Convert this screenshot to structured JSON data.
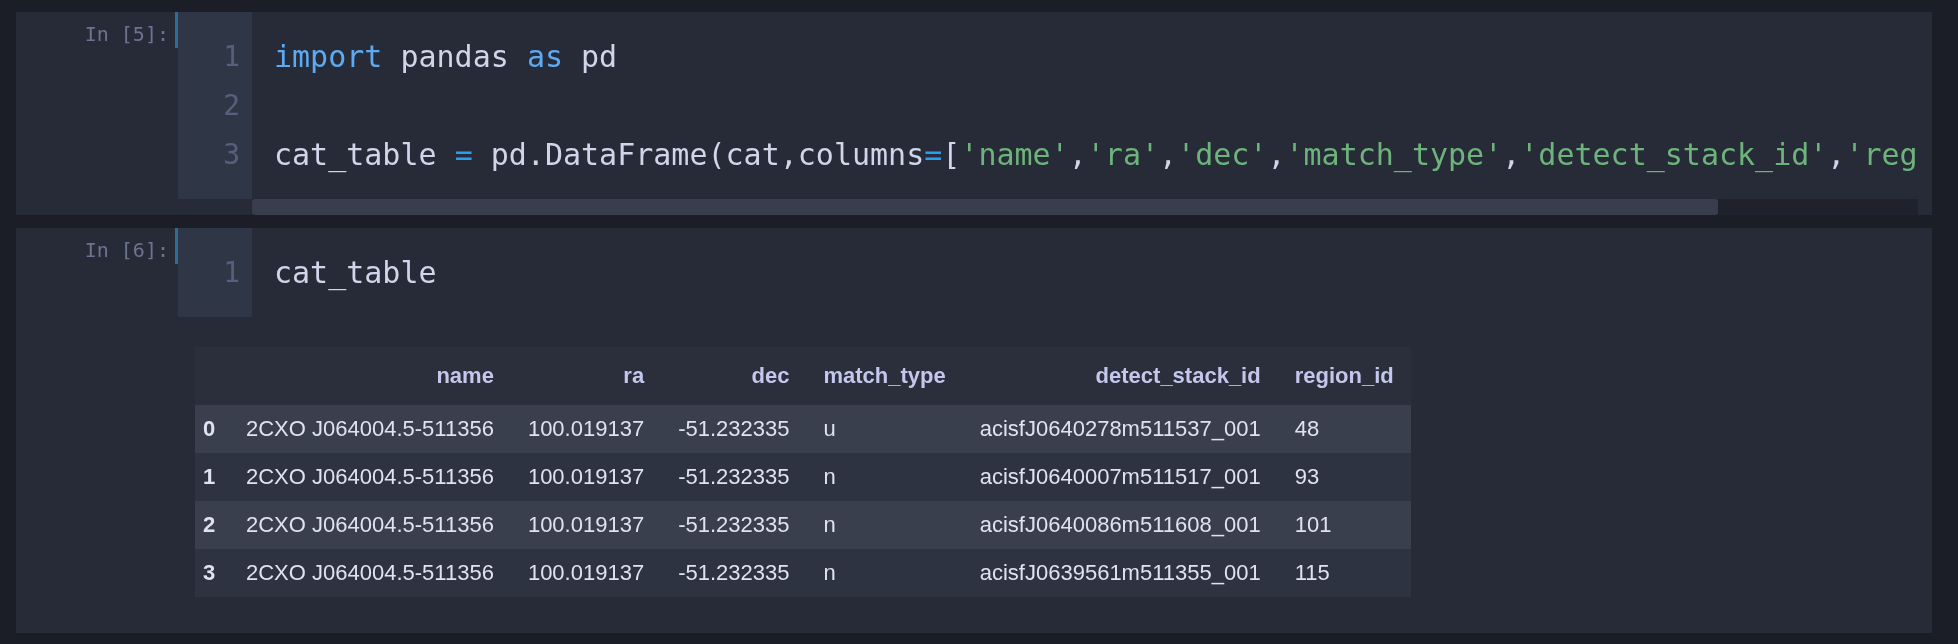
{
  "cells": [
    {
      "prompt": "In [5]:",
      "horizontal_scrollbar": true,
      "lines": [
        {
          "number": "1",
          "tokens": [
            {
              "kind": "keyword",
              "text": "import"
            },
            {
              "kind": "name",
              "text": " pandas "
            },
            {
              "kind": "keyword",
              "text": "as"
            },
            {
              "kind": "name",
              "text": " pd"
            }
          ]
        },
        {
          "number": "2"
        },
        {
          "number": "3",
          "tokens": [
            {
              "kind": "name",
              "text": "cat_table "
            },
            {
              "kind": "operator",
              "text": "="
            },
            {
              "kind": "name",
              "text": " pd.DataFrame(cat,columns"
            },
            {
              "kind": "operator",
              "text": "="
            },
            {
              "kind": "name",
              "text": "["
            },
            {
              "kind": "string",
              "text": "'name'"
            },
            {
              "kind": "name",
              "text": ","
            },
            {
              "kind": "string",
              "text": "'ra'"
            },
            {
              "kind": "name",
              "text": ","
            },
            {
              "kind": "string",
              "text": "'dec'"
            },
            {
              "kind": "name",
              "text": ","
            },
            {
              "kind": "string",
              "text": "'match_type'"
            },
            {
              "kind": "name",
              "text": ","
            },
            {
              "kind": "string",
              "text": "'detect_stack_id'"
            },
            {
              "kind": "name",
              "text": ","
            },
            {
              "kind": "string",
              "text": "'reg"
            }
          ]
        }
      ]
    },
    {
      "prompt": "In [6]:",
      "horizontal_scrollbar": false,
      "lines": [
        {
          "number": "1",
          "tokens": [
            {
              "kind": "name",
              "text": "cat_table"
            }
          ]
        }
      ],
      "output": {
        "table": {
          "columns": [
            {
              "label": "name",
              "kind": "right"
            },
            {
              "label": "ra",
              "kind": "right"
            },
            {
              "label": "dec",
              "kind": "right"
            },
            {
              "label": "match_type",
              "kind": "left"
            },
            {
              "label": "detect_stack_id",
              "kind": "right"
            },
            {
              "label": "region_id",
              "kind": "left"
            }
          ],
          "rows": [
            {
              "index": "0",
              "cells": [
                "2CXO J064004.5-511356",
                "100.019137",
                "-51.232335",
                "u",
                "acisfJ0640278m511537_001",
                "48"
              ]
            },
            {
              "index": "1",
              "cells": [
                "2CXO J064004.5-511356",
                "100.019137",
                "-51.232335",
                "n",
                "acisfJ0640007m511517_001",
                "93"
              ]
            },
            {
              "index": "2",
              "cells": [
                "2CXO J064004.5-511356",
                "100.019137",
                "-51.232335",
                "n",
                "acisfJ0640086m511608_001",
                "101"
              ]
            },
            {
              "index": "3",
              "cells": [
                "2CXO J064004.5-511356",
                "100.019137",
                "-51.232335",
                "n",
                "acisfJ0639561m511355_001",
                "115"
              ]
            }
          ]
        }
      }
    }
  ]
}
